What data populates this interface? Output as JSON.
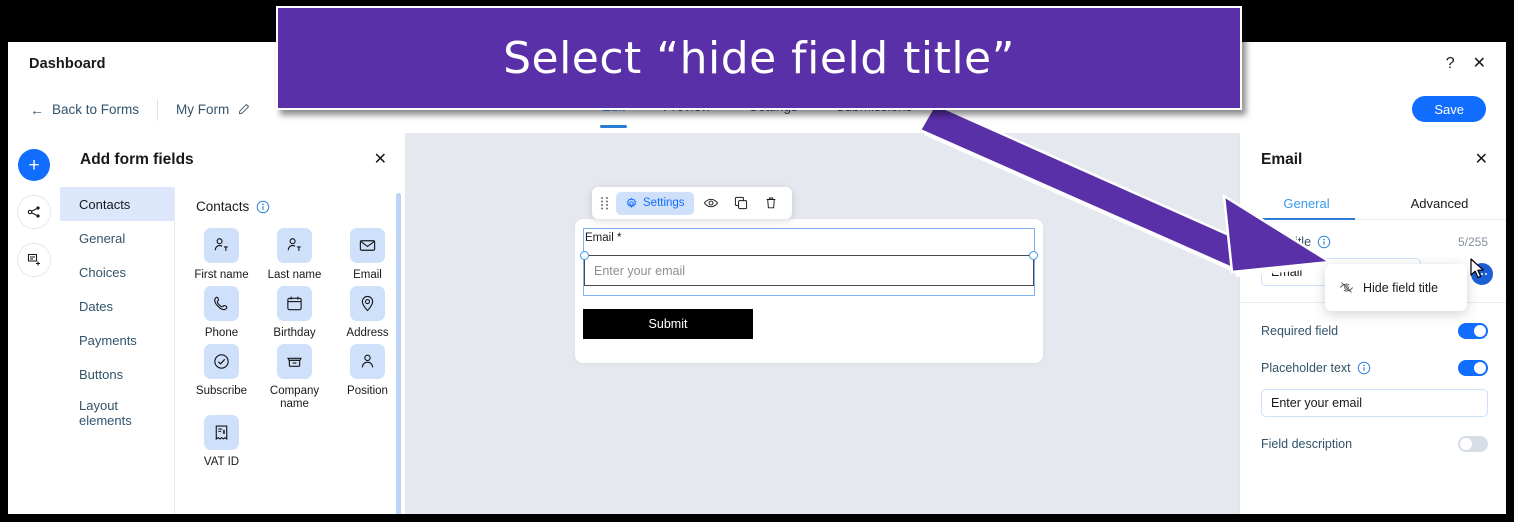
{
  "annotation": {
    "banner_text": "Select “hide field title”",
    "banner_color": "#5a30a8",
    "arrow_color": "#5a30a8"
  },
  "titlebar": {
    "title": "Dashboard",
    "help_icon": "?",
    "close_icon": "✕"
  },
  "toolbar": {
    "back_label": "Back to Forms",
    "back_icon": "←",
    "form_name": "My Form",
    "edit_name_icon": "pencil-icon",
    "save_label": "Save",
    "tabs": [
      {
        "label": "Edit",
        "active": true
      },
      {
        "label": "Preview",
        "active": false
      },
      {
        "label": "Settings",
        "active": false
      },
      {
        "label": "Submissions",
        "active": false
      }
    ]
  },
  "rail": {
    "items": [
      {
        "icon": "plus-icon",
        "primary": true
      },
      {
        "icon": "share-branch-icon",
        "primary": false
      },
      {
        "icon": "add-page-icon",
        "primary": false
      }
    ]
  },
  "fields_panel": {
    "title": "Add form fields",
    "close_icon": "✕",
    "categories": [
      {
        "label": "Contacts",
        "active": true
      },
      {
        "label": "General",
        "active": false
      },
      {
        "label": "Choices",
        "active": false
      },
      {
        "label": "Dates",
        "active": false
      },
      {
        "label": "Payments",
        "active": false
      },
      {
        "label": "Buttons",
        "active": false
      },
      {
        "label": "Layout elements",
        "active": false
      }
    ],
    "group_heading": "Contacts",
    "group_info_icon": "info-icon",
    "fields": [
      {
        "label": "First name",
        "icon": "person-text-icon"
      },
      {
        "label": "Last name",
        "icon": "person-text-icon"
      },
      {
        "label": "Email",
        "icon": "envelope-icon"
      },
      {
        "label": "Phone",
        "icon": "phone-icon"
      },
      {
        "label": "Birthday",
        "icon": "calendar-icon"
      },
      {
        "label": "Address",
        "icon": "map-pin-icon"
      },
      {
        "label": "Subscribe",
        "icon": "check-circle-icon"
      },
      {
        "label": "Company name",
        "icon": "store-icon"
      },
      {
        "label": "Position",
        "icon": "person-icon"
      },
      {
        "label": "VAT ID",
        "icon": "receipt-dollar-icon"
      }
    ]
  },
  "canvas": {
    "field_toolbar": {
      "drag_icon": "drag-dots-icon",
      "settings_label": "Settings",
      "settings_icon": "gear-icon",
      "hide_icon": "eye-icon",
      "duplicate_icon": "duplicate-icon",
      "delete_icon": "trash-icon"
    },
    "form": {
      "field_label": "Email *",
      "field_placeholder": "Enter your email",
      "submit_label": "Submit"
    }
  },
  "settings_panel": {
    "title": "Email",
    "close_icon": "✕",
    "tabs": [
      {
        "label": "General",
        "active": true
      },
      {
        "label": "Advanced",
        "active": false
      }
    ],
    "field_title": {
      "label": "Field title",
      "info_icon": "info-icon",
      "counter": "5/255",
      "value": "Email",
      "more_icon": "more-dots-icon"
    },
    "dropdown": {
      "item_label": "Hide field title",
      "item_icon": "eye-slash-icon"
    },
    "options": [
      {
        "label": "Required field",
        "has_info": false,
        "toggle": "on"
      },
      {
        "label": "Placeholder text",
        "has_info": true,
        "toggle": "on"
      },
      {
        "label": "Field description",
        "has_info": false,
        "toggle": "off"
      }
    ],
    "placeholder_value": "Enter your email"
  }
}
